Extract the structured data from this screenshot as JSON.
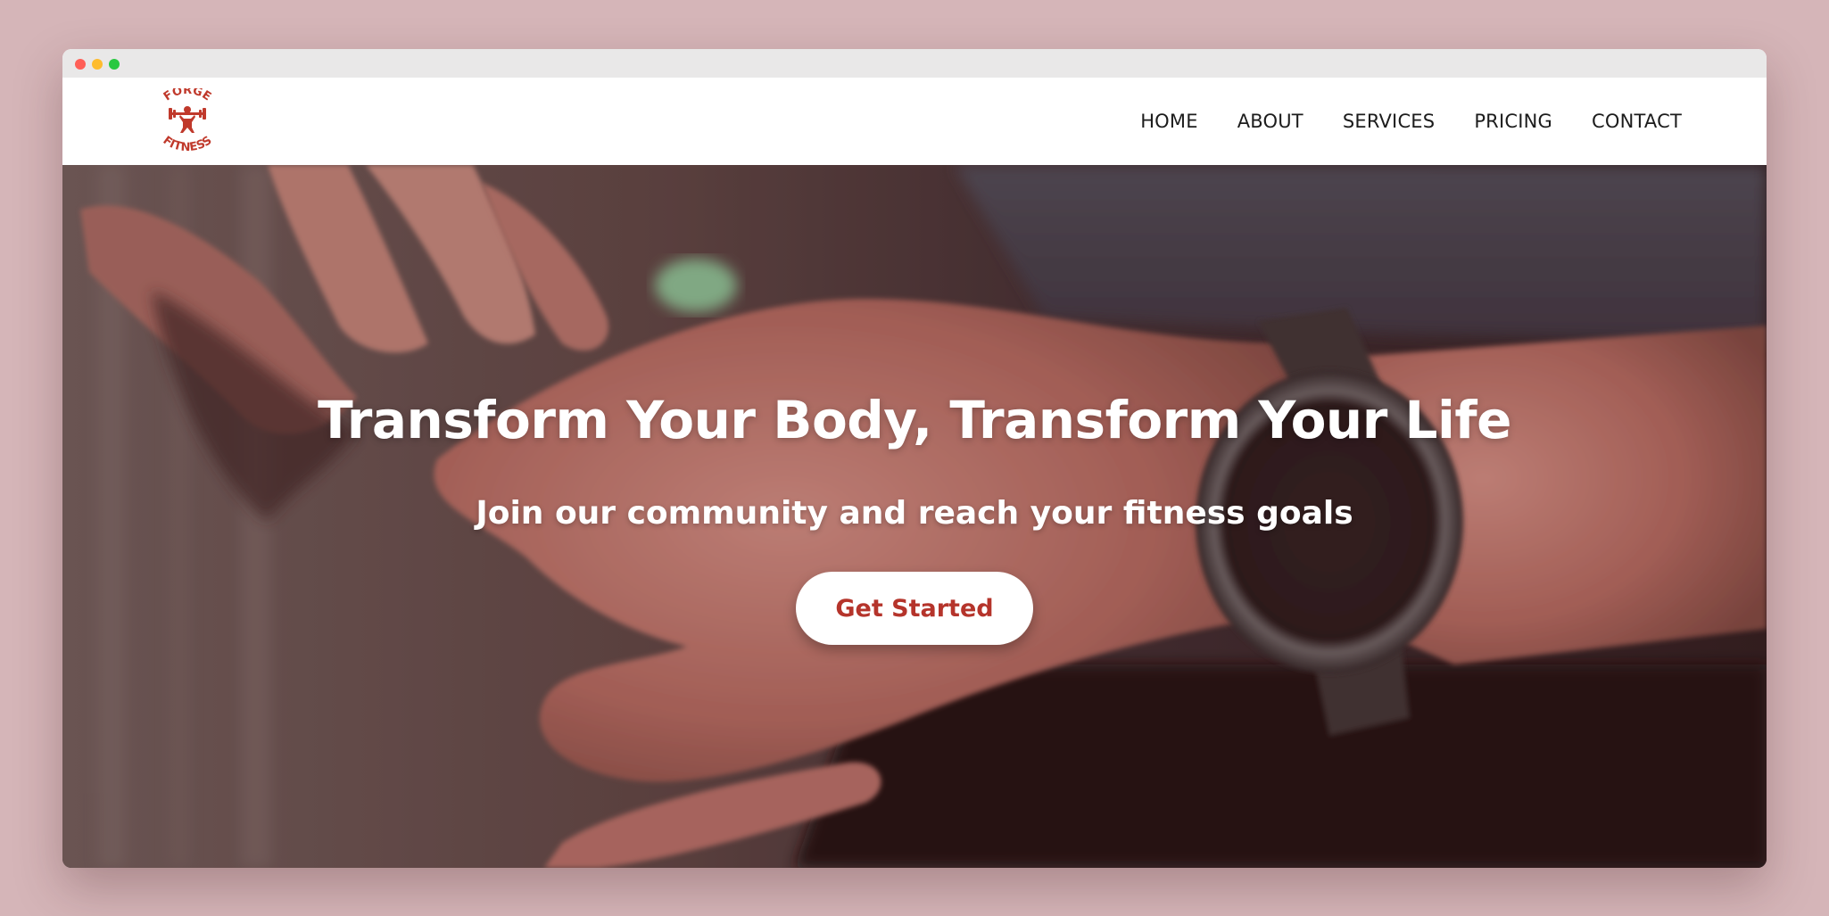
{
  "window": {
    "controls": [
      "close",
      "minimize",
      "maximize"
    ]
  },
  "brand": {
    "logo_text_top": "FORGE",
    "logo_text_bottom": "FITNESS",
    "logo_icon": "weightlifter-icon",
    "color": "#c0392b"
  },
  "nav": {
    "items": [
      {
        "label": "HOME"
      },
      {
        "label": "ABOUT"
      },
      {
        "label": "SERVICES"
      },
      {
        "label": "PRICING"
      },
      {
        "label": "CONTACT"
      }
    ]
  },
  "hero": {
    "title": "Transform Your Body, Transform Your Life",
    "subtitle": "Join our community and reach your fitness goals",
    "cta_label": "Get Started",
    "image": "hands-with-smartwatch-photo"
  },
  "colors": {
    "page_background": "#d5b5b8",
    "accent": "#b5342b",
    "overlay": "#5a2a2a"
  }
}
